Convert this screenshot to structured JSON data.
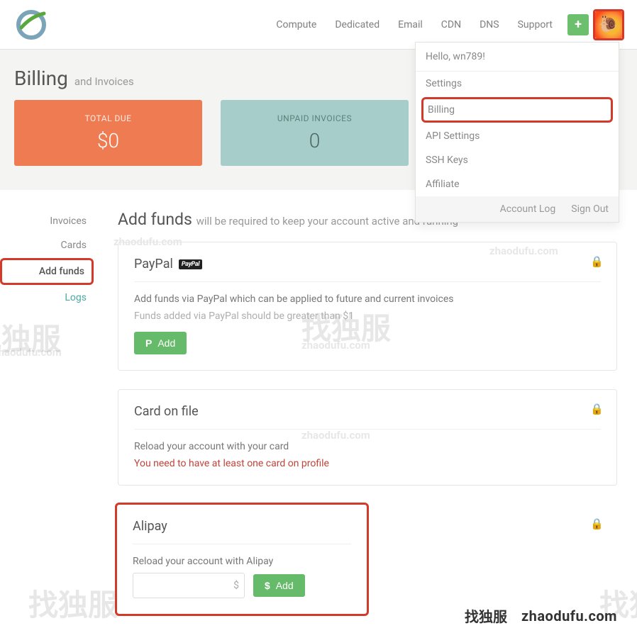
{
  "nav": {
    "items": [
      "Compute",
      "Dedicated",
      "Email",
      "CDN",
      "DNS",
      "Support"
    ]
  },
  "dropdown": {
    "greeting": "Hello, wn789!",
    "items": [
      "Settings",
      "Billing",
      "API Settings",
      "SSH Keys",
      "Affiliate"
    ],
    "account_log": "Account Log",
    "sign_out": "Sign Out"
  },
  "page": {
    "title": "Billing",
    "subtitle": "and Invoices"
  },
  "stats": {
    "total_due_label": "TOTAL DUE",
    "total_due_value": "$0",
    "unpaid_label": "UNPAID INVOICES",
    "unpaid_value": "0"
  },
  "sidenav": {
    "items": [
      {
        "label": "Invoices"
      },
      {
        "label": "Cards"
      },
      {
        "label": "Add funds"
      },
      {
        "label": "Logs"
      }
    ]
  },
  "content": {
    "title": "Add funds",
    "subtitle": "will be required to keep your account active and running"
  },
  "paypal": {
    "heading": "PayPal",
    "badge": "PayPal",
    "desc": "Add funds via PayPal which can be applied to future and current invoices",
    "note": "Funds added via PayPal should be greater than $1",
    "add_label": "Add"
  },
  "card": {
    "heading": "Card on file",
    "desc": "Reload your account with your card",
    "warn": "You need to have at least one card on profile"
  },
  "alipay": {
    "heading": "Alipay",
    "desc": "Reload your account with Alipay",
    "currency": "$",
    "add_label": "Add"
  },
  "watermarks": {
    "cn": "找独服",
    "url": "zhaodufu.com"
  }
}
